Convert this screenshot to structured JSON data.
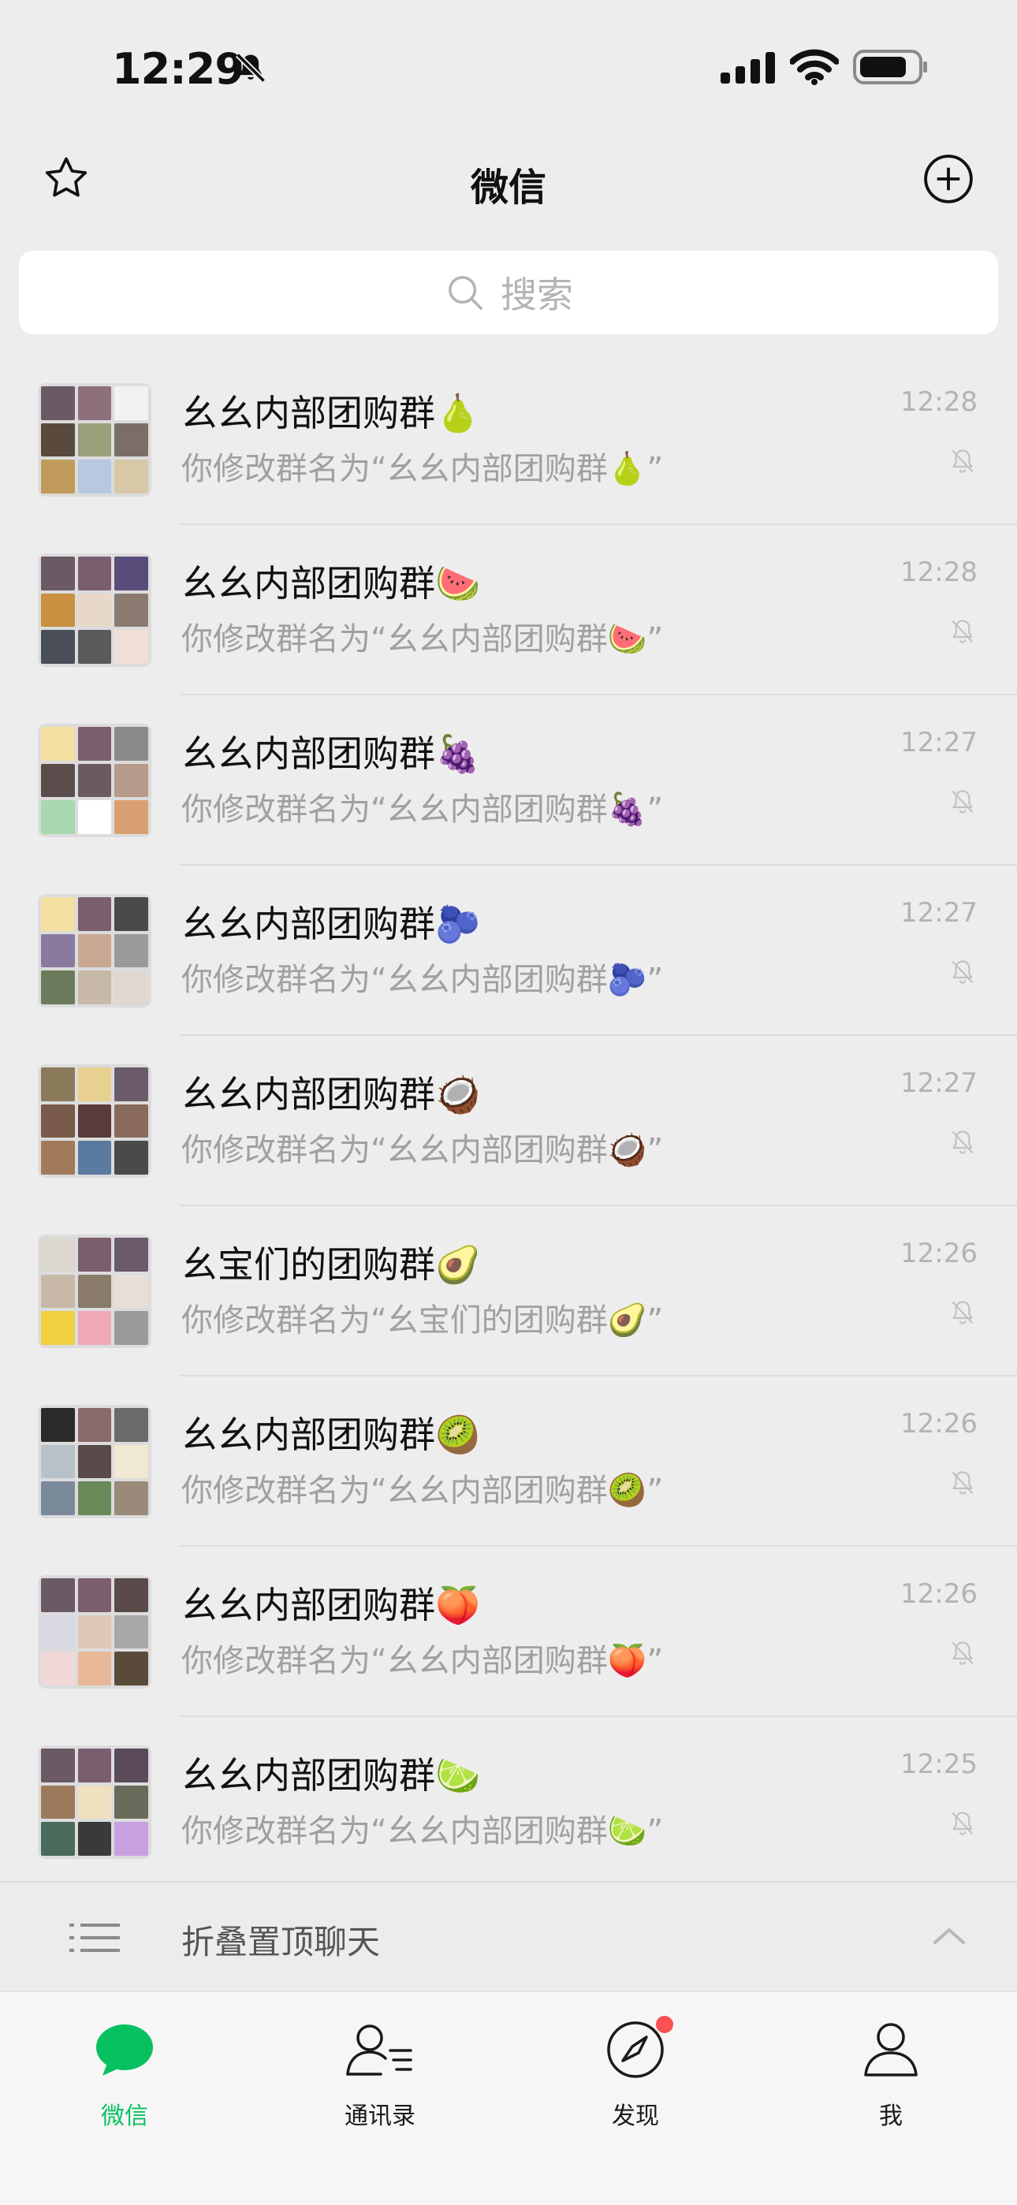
{
  "status_bar": {
    "time": "12:29",
    "icons": [
      "bell-slash-icon",
      "signal-icon",
      "wifi-icon",
      "battery-icon"
    ]
  },
  "nav": {
    "title": "微信",
    "left_icon": "star-icon",
    "right_icon": "plus-circle-icon"
  },
  "search": {
    "placeholder": "搜索"
  },
  "chats": [
    {
      "name": "幺幺内部团购群🍐",
      "preview": "你修改群名为“幺幺内部团购群🍐”",
      "time": "12:28",
      "muted": true
    },
    {
      "name": "幺幺内部团购群🍉",
      "preview": "你修改群名为“幺幺内部团购群🍉”",
      "time": "12:28",
      "muted": true
    },
    {
      "name": "幺幺内部团购群🍇",
      "preview": "你修改群名为“幺幺内部团购群🍇”",
      "time": "12:27",
      "muted": true
    },
    {
      "name": "幺幺内部团购群🫐",
      "preview": "你修改群名为“幺幺内部团购群🫐”",
      "time": "12:27",
      "muted": true
    },
    {
      "name": "幺幺内部团购群🥥",
      "preview": "你修改群名为“幺幺内部团购群🥥”",
      "time": "12:27",
      "muted": true
    },
    {
      "name": "幺宝们的团购群🥑",
      "preview": "你修改群名为“幺宝们的团购群🥑”",
      "time": "12:26",
      "muted": true
    },
    {
      "name": "幺幺内部团购群🥝",
      "preview": "你修改群名为“幺幺内部团购群🥝”",
      "time": "12:26",
      "muted": true
    },
    {
      "name": "幺幺内部团购群🍑",
      "preview": "你修改群名为“幺幺内部团购群🍑”",
      "time": "12:26",
      "muted": true
    },
    {
      "name": "幺幺内部团购群🍋‍🟩",
      "preview": "你修改群名为“幺幺内部团购群🍋‍🟩”",
      "time": "12:25",
      "muted": true
    }
  ],
  "fold": {
    "label": "折叠置顶聊天"
  },
  "tabs": [
    {
      "label": "微信",
      "icon": "chat-bubble-icon",
      "active": true
    },
    {
      "label": "通讯录",
      "icon": "contacts-icon",
      "active": false
    },
    {
      "label": "发现",
      "icon": "compass-icon",
      "active": false,
      "badge": true
    },
    {
      "label": "我",
      "icon": "person-icon",
      "active": false
    }
  ],
  "colors": {
    "accent": "#07c160",
    "background": "#ededed",
    "badge": "#fa5151",
    "secondary_text": "#a0a0a0"
  }
}
